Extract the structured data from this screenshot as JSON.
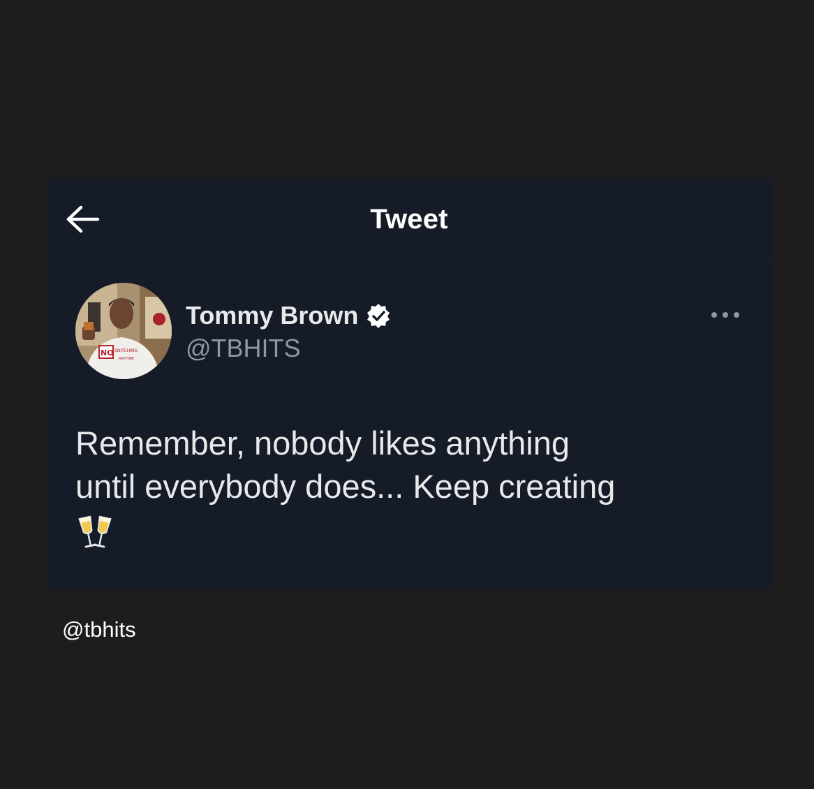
{
  "header": {
    "title": "Tweet",
    "back_icon": "arrow-left-icon"
  },
  "tweet": {
    "author_name": "Tommy Brown",
    "author_handle": "@TBHITS",
    "verified_icon": "verified-badge-icon",
    "more_icon": "more-options-icon",
    "text_line1": "Remember, nobody likes anything",
    "text_line2": "until everybody does... Keep creating",
    "emoji": "clinking-glasses-icon"
  },
  "watermark": "@tbhits",
  "colors": {
    "page_bg": "#1d1d1d",
    "card_bg": "#151c28",
    "text_primary": "#e7e9ea",
    "text_secondary": "#8b98a5",
    "verified": "#ffffff"
  }
}
